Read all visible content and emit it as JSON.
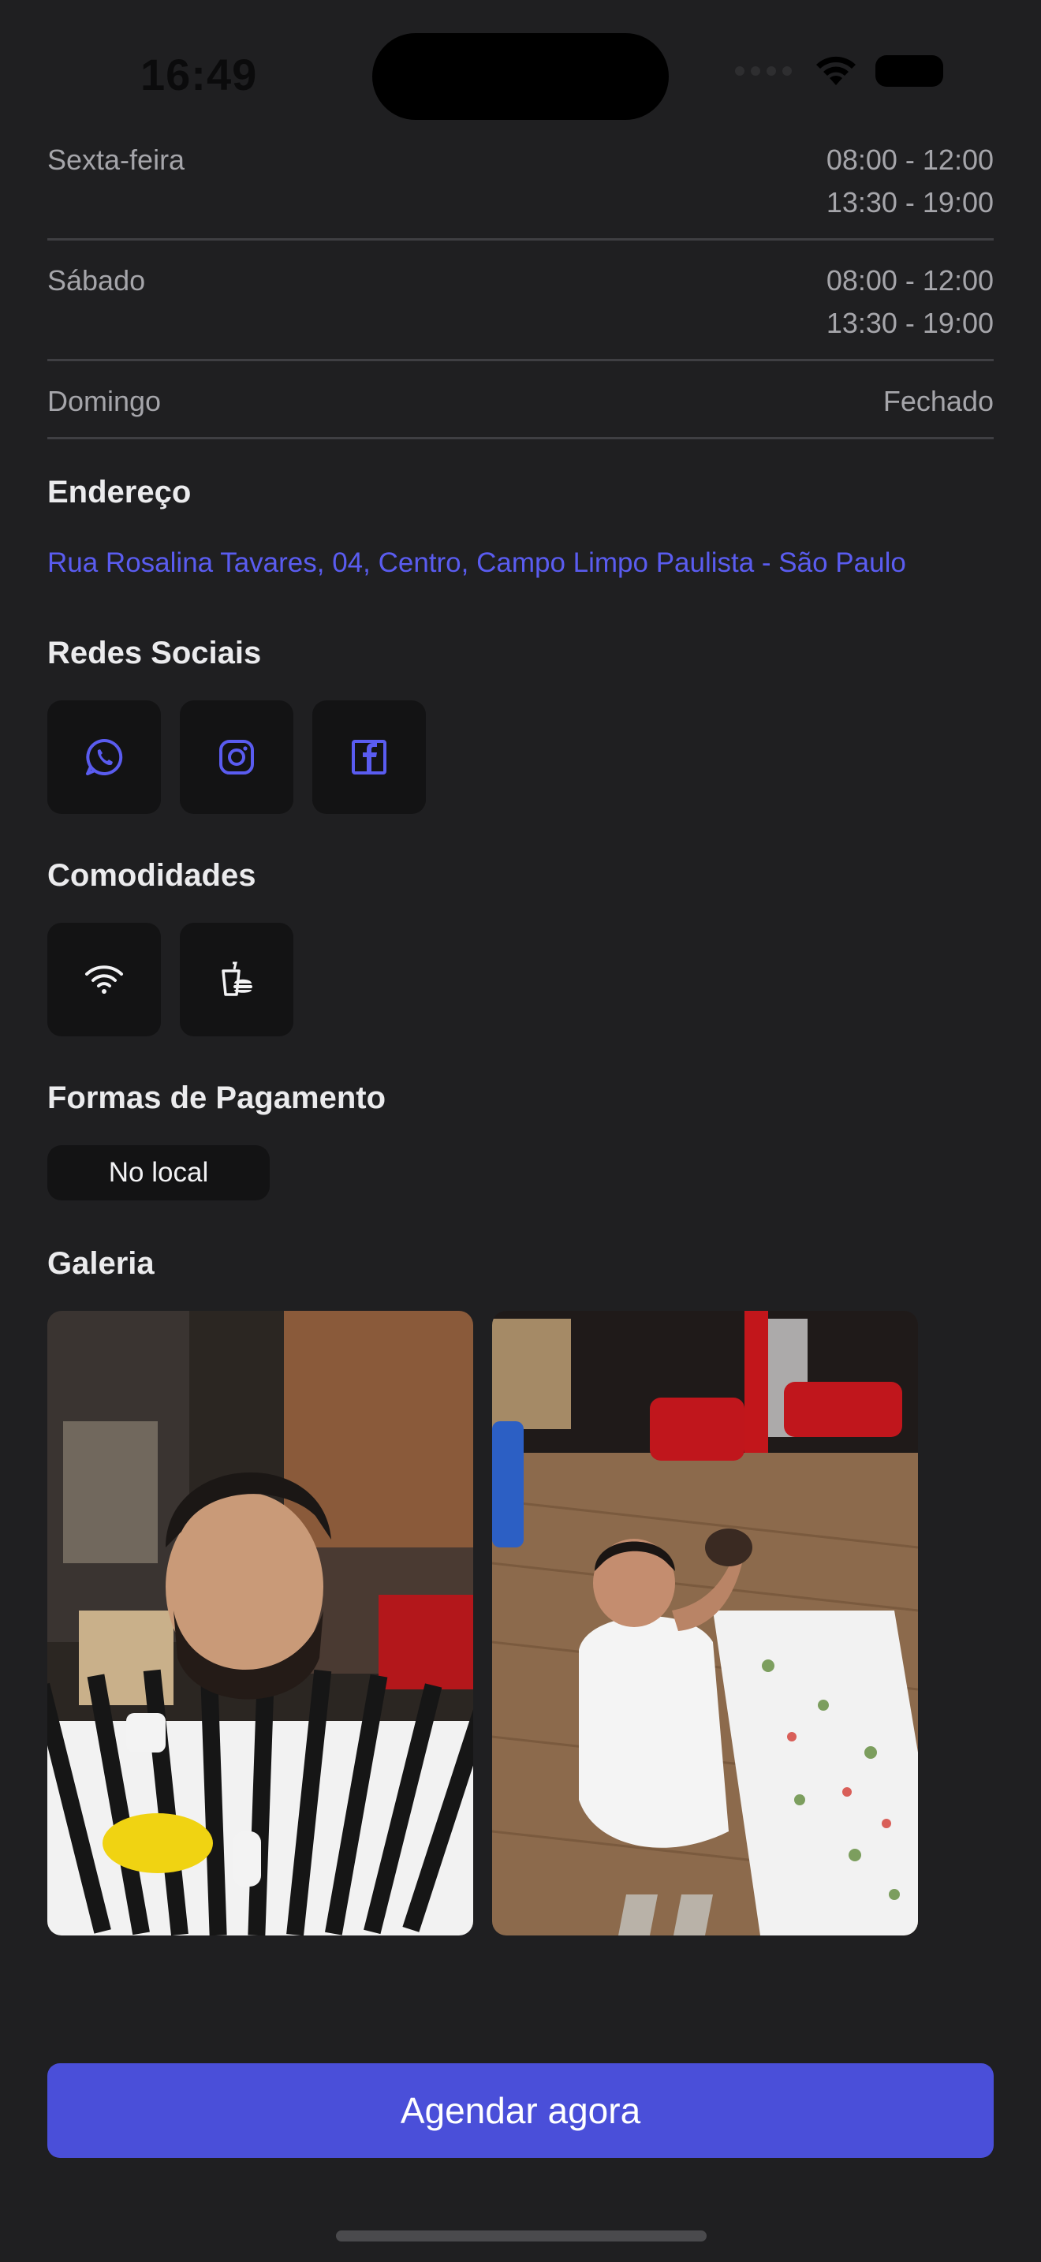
{
  "status_bar": {
    "time": "16:49"
  },
  "hours": [
    {
      "day": "Sexta-feira",
      "times": [
        "08:00 - 12:00",
        "13:30 - 19:00"
      ]
    },
    {
      "day": "Sábado",
      "times": [
        "08:00 - 12:00",
        "13:30 - 19:00"
      ]
    },
    {
      "day": "Domingo",
      "times": [
        "Fechado"
      ]
    }
  ],
  "address": {
    "title": "Endereço",
    "text": "Rua Rosalina Tavares, 04, Centro, Campo Limpo Paulista - São Paulo"
  },
  "social": {
    "title": "Redes Sociais",
    "icons": [
      "whatsapp-icon",
      "instagram-icon",
      "facebook-icon"
    ]
  },
  "amenities": {
    "title": "Comodidades",
    "icons": [
      "wifi-icon",
      "food-drink-icon"
    ]
  },
  "payment": {
    "title": "Formas de Pagamento",
    "option": "No local"
  },
  "gallery": {
    "title": "Galeria"
  },
  "cta": {
    "label": "Agendar agora"
  },
  "colors": {
    "background": "#1f1f21",
    "accent": "#4a4fd9",
    "link": "#5a5cf0",
    "tile": "#131314"
  }
}
